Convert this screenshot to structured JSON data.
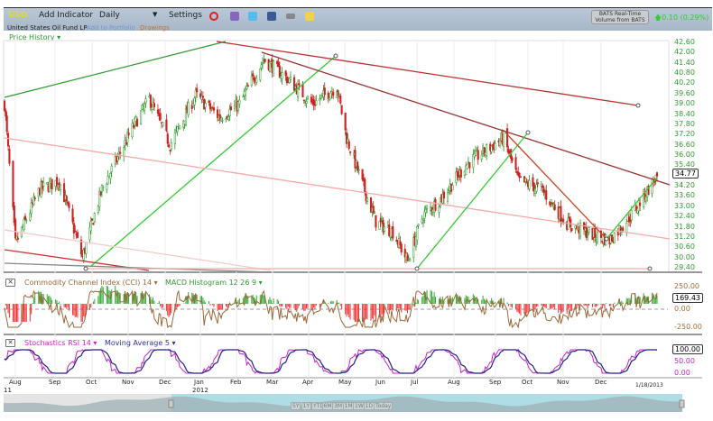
{
  "toolbar": {
    "symbol": "USO",
    "add_indicator": "Add Indicator",
    "interval": "Daily",
    "settings": "Settings",
    "company": "United States Oil Fund LP",
    "add_portfolio": "Add to Portfolio",
    "drawings": "Drawings",
    "bats_line1": "BATS Real-Time",
    "bats_line2": "Volume from BATS",
    "change": "0.10 (0.29%)",
    "icons": [
      "alarm-clock-icon",
      "books-icon",
      "twitter-icon",
      "facebook-icon",
      "camera-icon",
      "note-icon"
    ]
  },
  "price_panel": {
    "title": "Price History",
    "last_price": "34.77",
    "y_ticks": [
      "42.60",
      "42.00",
      "41.40",
      "40.80",
      "40.20",
      "39.60",
      "39.00",
      "38.40",
      "37.80",
      "37.20",
      "36.60",
      "36.00",
      "35.40",
      "34.20",
      "33.60",
      "33.00",
      "32.40",
      "31.80",
      "31.20",
      "30.60",
      "30.00",
      "29.40"
    ]
  },
  "cci_panel": {
    "title": "Commodity Channel Index (CCI) 14",
    "title2": "MACD Histogram 12 26 9",
    "last_value": "169.43",
    "y_ticks": [
      "250.00",
      "0.00",
      "-250.00"
    ]
  },
  "stoch_panel": {
    "title": "Stochastics RSI 14",
    "title2": "Moving Average 5",
    "last_value": "100.00",
    "y_ticks": [
      "50.00",
      "0.00"
    ]
  },
  "x_axis": {
    "months": [
      "Aug",
      "Sep",
      "Oct",
      "Nov",
      "Dec",
      "Jan",
      "Feb",
      "Mar",
      "Apr",
      "May",
      "Jun",
      "Jul",
      "Aug",
      "Sep",
      "Oct",
      "Nov",
      "Dec"
    ],
    "year_start": "11",
    "year_2012": "2012",
    "end_date": "1/18/2013"
  },
  "navigator": {
    "ranges": [
      "5Y",
      "1Y",
      "YTD",
      "6M",
      "3M",
      "1M",
      "1W",
      "1D",
      "Today"
    ]
  },
  "chart_data": {
    "type": "candlestick",
    "ylim": [
      29.4,
      42.6
    ],
    "approx_closes": [
      [
        "2011-08-01",
        39.0
      ],
      [
        "2011-08-10",
        30.8
      ],
      [
        "2011-08-30",
        34.0
      ],
      [
        "2011-09-15",
        34.5
      ],
      [
        "2011-10-04",
        30.0
      ],
      [
        "2011-10-20",
        34.0
      ],
      [
        "2011-11-15",
        37.7
      ],
      [
        "2011-11-28",
        39.3
      ],
      [
        "2011-12-15",
        36.6
      ],
      [
        "2012-01-05",
        39.5
      ],
      [
        "2012-01-25",
        38.2
      ],
      [
        "2012-02-10",
        39.0
      ],
      [
        "2012-03-01",
        41.6
      ],
      [
        "2012-03-20",
        40.5
      ],
      [
        "2012-04-10",
        39.0
      ],
      [
        "2012-04-30",
        40.0
      ],
      [
        "2012-05-08",
        37.0
      ],
      [
        "2012-05-20",
        34.5
      ],
      [
        "2012-06-01",
        32.1
      ],
      [
        "2012-06-15",
        31.5
      ],
      [
        "2012-06-27",
        29.8
      ],
      [
        "2012-07-10",
        32.5
      ],
      [
        "2012-07-25",
        33.5
      ],
      [
        "2012-08-15",
        35.5
      ],
      [
        "2012-09-14",
        37.0
      ],
      [
        "2012-09-26",
        34.5
      ],
      [
        "2012-10-15",
        34.0
      ],
      [
        "2012-11-05",
        32.0
      ],
      [
        "2012-11-20",
        31.5
      ],
      [
        "2012-12-10",
        31.0
      ],
      [
        "2012-12-28",
        32.5
      ],
      [
        "2013-01-18",
        34.77
      ]
    ]
  },
  "colors": {
    "up": "#229922",
    "down": "#cc2222",
    "cci": "#9a6a3a",
    "stoch": "#cc22cc",
    "ma": "#222288"
  }
}
